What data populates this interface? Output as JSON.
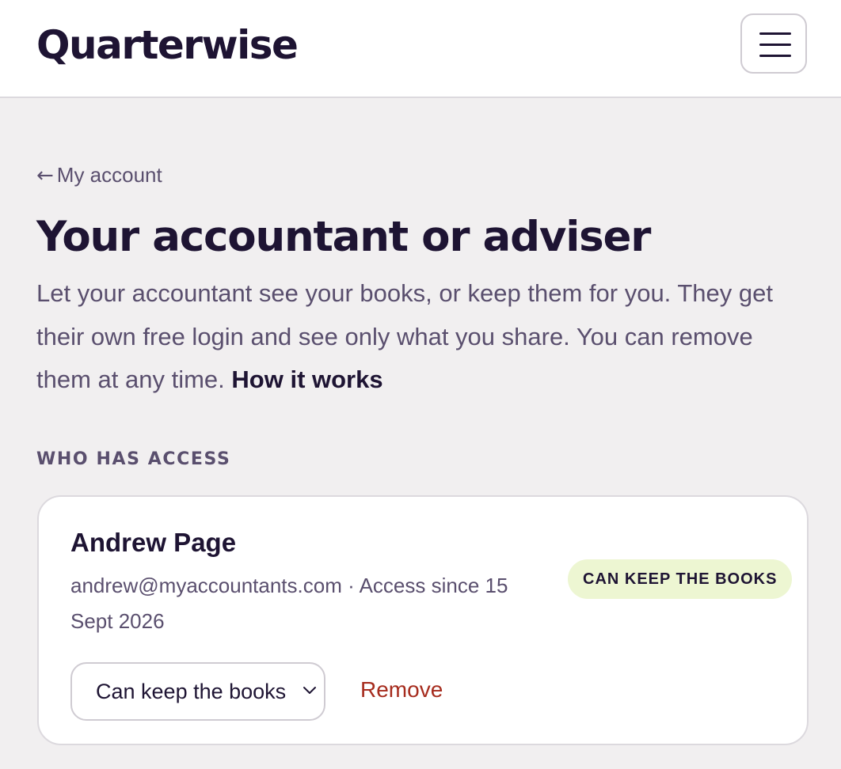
{
  "header": {
    "logo_text": "Quarterwise",
    "menu_icon": "hamburger-menu-icon"
  },
  "breadcrumb": {
    "back_icon": "left-arrow-icon",
    "label": "My account"
  },
  "page": {
    "title": "Your accountant or adviser",
    "intro_text": "Let your accountant see your books, or keep them for you. They get their own free login and see only what you share. You can remove them at any time.",
    "intro_link": "How it works"
  },
  "access_section": {
    "heading": "WHO HAS ACCESS",
    "people": [
      {
        "name": "Andrew Page",
        "email": "andrew@myaccountants.com",
        "separator": "·",
        "access_since": "Access since 15 Sept 2026",
        "badge": "CAN KEEP THE BOOKS",
        "role_selected": "Can keep the books",
        "remove_label": "Remove"
      }
    ]
  },
  "colors": {
    "page_background": "#f1eff0",
    "text_dark": "#1e1433",
    "text_muted": "#5a4f6e",
    "badge_background": "#edf6d2",
    "remove_red": "#a62c1e"
  }
}
